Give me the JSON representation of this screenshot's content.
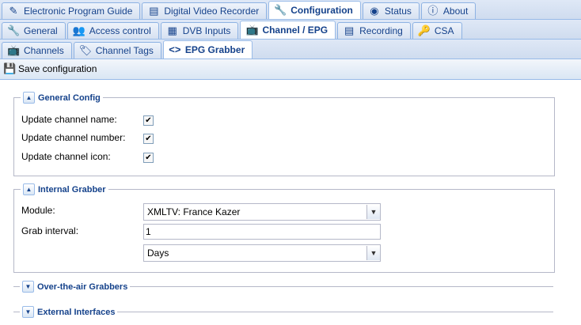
{
  "main_tabs": [
    {
      "label": "Electronic Program Guide",
      "icon": "pencil-icon",
      "active": false
    },
    {
      "label": "Digital Video Recorder",
      "icon": "video-icon",
      "active": false
    },
    {
      "label": "Configuration",
      "icon": "wrench-icon",
      "active": true
    },
    {
      "label": "Status",
      "icon": "eye-icon",
      "active": false
    },
    {
      "label": "About",
      "icon": "info-icon",
      "active": false
    }
  ],
  "config_tabs": [
    {
      "label": "General",
      "icon": "wrench-icon",
      "active": false
    },
    {
      "label": "Access control",
      "icon": "users-icon",
      "active": false
    },
    {
      "label": "DVB Inputs",
      "icon": "card-icon",
      "active": false
    },
    {
      "label": "Channel / EPG",
      "icon": "tv-icon",
      "active": true
    },
    {
      "label": "Recording",
      "icon": "video-icon",
      "active": false
    },
    {
      "label": "CSA",
      "icon": "key-icon",
      "active": false
    }
  ],
  "sub_tabs": [
    {
      "label": "Channels",
      "icon": "tv-icon",
      "active": false
    },
    {
      "label": "Channel Tags",
      "icon": "tag-icon",
      "active": false
    },
    {
      "label": "EPG Grabber",
      "icon": "code-icon",
      "active": true
    }
  ],
  "toolbar": {
    "save_label": "Save configuration",
    "save_icon": "save-icon"
  },
  "general_config": {
    "title": "General Config",
    "update_name_label": "Update channel name:",
    "update_number_label": "Update channel number:",
    "update_icon_label": "Update channel icon:",
    "update_name": true,
    "update_number": true,
    "update_icon": true
  },
  "internal_grabber": {
    "title": "Internal Grabber",
    "module_label": "Module:",
    "module_value": "XMLTV: France Kazer",
    "interval_label": "Grab interval:",
    "interval_value": "1",
    "unit_value": "Days"
  },
  "ota_grabbers": {
    "title": "Over-the-air Grabbers"
  },
  "external_interfaces": {
    "title": "External Interfaces"
  },
  "colors": {
    "accent": "#15428b",
    "border": "#99bbe8"
  }
}
